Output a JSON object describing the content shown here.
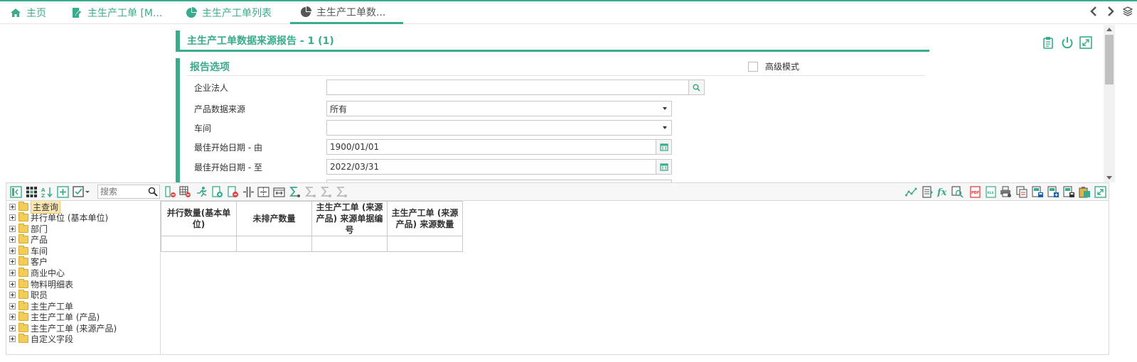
{
  "tabs": [
    {
      "label": "主页",
      "icon": "home-icon"
    },
    {
      "label": "主生产工单 [M...",
      "icon": "edit-doc-icon"
    },
    {
      "label": "主生产工单列表",
      "icon": "pie-chart-icon"
    },
    {
      "label": "主生产工单数...",
      "icon": "pie-chart-icon",
      "active": true
    }
  ],
  "report": {
    "title": "主生产工单数据来源报告 - 1 (1)",
    "options_heading": "报告选项",
    "advanced_mode_label": "高级模式",
    "fields": [
      {
        "label": "企业法人",
        "value": "",
        "kind": "lookup"
      },
      {
        "label": "产品数据来源",
        "value": "所有",
        "kind": "select"
      },
      {
        "label": "车间",
        "value": "",
        "kind": "select"
      },
      {
        "label": "最佳开始日期 - 由",
        "value": "1900/01/01",
        "kind": "date"
      },
      {
        "label": "最佳开始日期 - 至",
        "value": "2022/03/31",
        "kind": "date"
      }
    ]
  },
  "pivot": {
    "search_placeholder": "搜索",
    "tree": [
      {
        "label": "主查询",
        "selected": true
      },
      {
        "label": "并行单位 (基本单位)"
      },
      {
        "label": "部门"
      },
      {
        "label": "产品"
      },
      {
        "label": "车间"
      },
      {
        "label": "客户"
      },
      {
        "label": "商业中心"
      },
      {
        "label": "物料明细表"
      },
      {
        "label": "职员"
      },
      {
        "label": "主生产工单"
      },
      {
        "label": "主生产工单 (产品)"
      },
      {
        "label": "主生产工单 (来源产品)"
      },
      {
        "label": "自定义字段"
      }
    ],
    "columns": [
      "并行数量(基本单位)",
      "未排产数量",
      "主生产工单 (来源产品) 来源单据编号",
      "主生产工单 (来源产品) 来源数量"
    ]
  },
  "colors": {
    "accent": "#3aab8c",
    "folder": "#f3cd5a",
    "active_tab_text": "#555555"
  }
}
